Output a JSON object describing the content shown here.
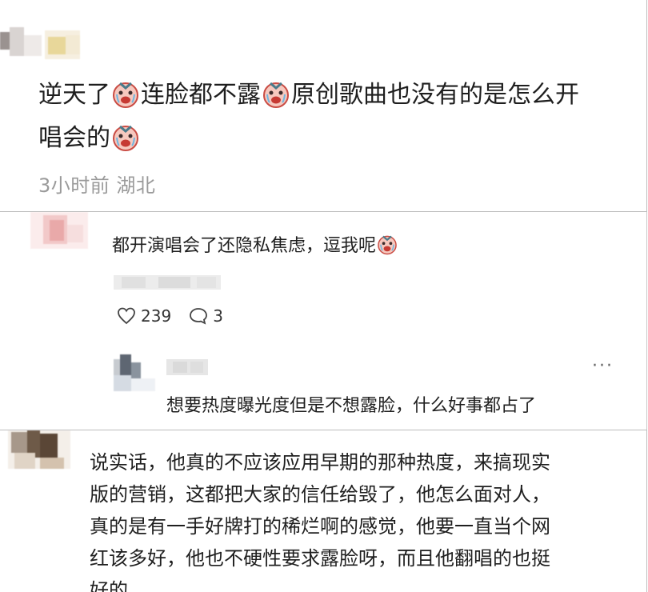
{
  "comment_main": {
    "text_line1": "逆天了",
    "text_seg2": "连脸都不露",
    "text_seg3": "原创歌曲也没有的是怎么开",
    "text_line2": "唱会的",
    "meta": "3小时前 湖北"
  },
  "reply_block": {
    "text": "都开演唱会了还隐私焦虑，逗我呢",
    "likes": "239",
    "comments": "3",
    "nested_reply": {
      "more_label": "···",
      "text": "想要热度曝光度但是不想露脸，什么好事都占了"
    }
  },
  "comment_third": {
    "lines": [
      "说实话，他真的不应该应用早期的那种热度，来搞现实",
      "版的营销，这都把大家的信任给毁了，他怎么面对人，",
      "真的是有一手好牌打的稀烂啊的感觉，他要一直当个网",
      "红该多好，他也不硬性要求露脸呀，而且他翻唱的也挺",
      "好的"
    ]
  },
  "icons": {
    "emoji": "crying-face-emoji",
    "like": "heart-icon",
    "comment": "speech-bubble-icon"
  },
  "colors": {
    "meta_gray": "#9a9a9a",
    "emoji_red": "#e05a55",
    "border": "#bdbdbd"
  }
}
